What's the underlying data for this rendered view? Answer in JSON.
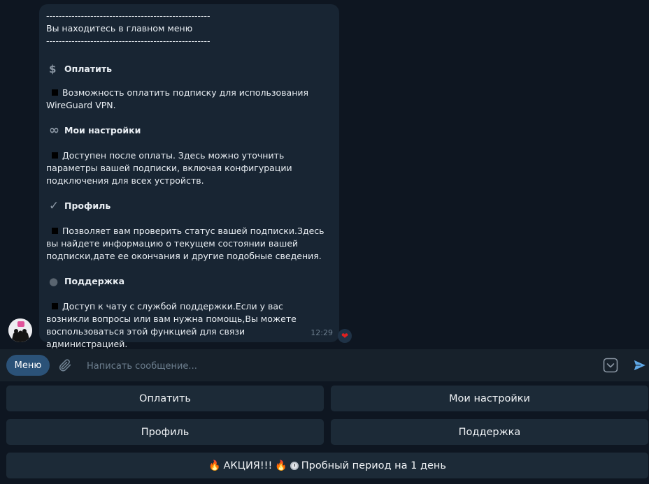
{
  "message": {
    "divider": "----------------------------------------------------",
    "intro": "Вы находитесь в главном меню",
    "sections": [
      {
        "icon": "dollar-icon",
        "glyph": "$",
        "title": "Оплатить",
        "text": "Возможность оплатить подписку для использования WireGuard VPN."
      },
      {
        "icon": "infinity-icon",
        "glyph": "∞",
        "title": "Мои настройки",
        "text": "Доступен после оплаты. Здесь можно уточнить параметры вашей подписки, включая конфигурации подключения для всех устройств."
      },
      {
        "icon": "checkmark-icon",
        "glyph": "✓",
        "title": "Профиль",
        "text": "Позволяет вам проверить статус вашей подписки.Здесь вы найдете информацию о текущем состоянии вашей подписки,дате ее окончания и другие подобные сведения."
      },
      {
        "icon": "speech-bubble-icon",
        "glyph": "●",
        "title": "Поддержка",
        "text": "Доступ к чату с службой поддержки.Если у вас возникли вопросы или вам нужна помощь,Вы можете воспользоваться этой функцией для связи администрацией."
      }
    ],
    "time": "12:29",
    "reaction": "❤"
  },
  "input": {
    "menu_label": "Меню",
    "placeholder": "Написать сообщение..."
  },
  "keyboard": {
    "btn_pay": "Оплатить",
    "btn_settings": "Мои настройки",
    "btn_profile": "Профиль",
    "btn_support": "Поддержка",
    "promo_fire": "🔥",
    "promo_text": "АКЦИЯ!!!",
    "promo_trial": "Пробный период на 1 день"
  },
  "colors": {
    "background": "#0e1621",
    "bubble": "#182533",
    "panel": "#17212b",
    "accent": "#2b5278",
    "button": "#1c2a37"
  }
}
